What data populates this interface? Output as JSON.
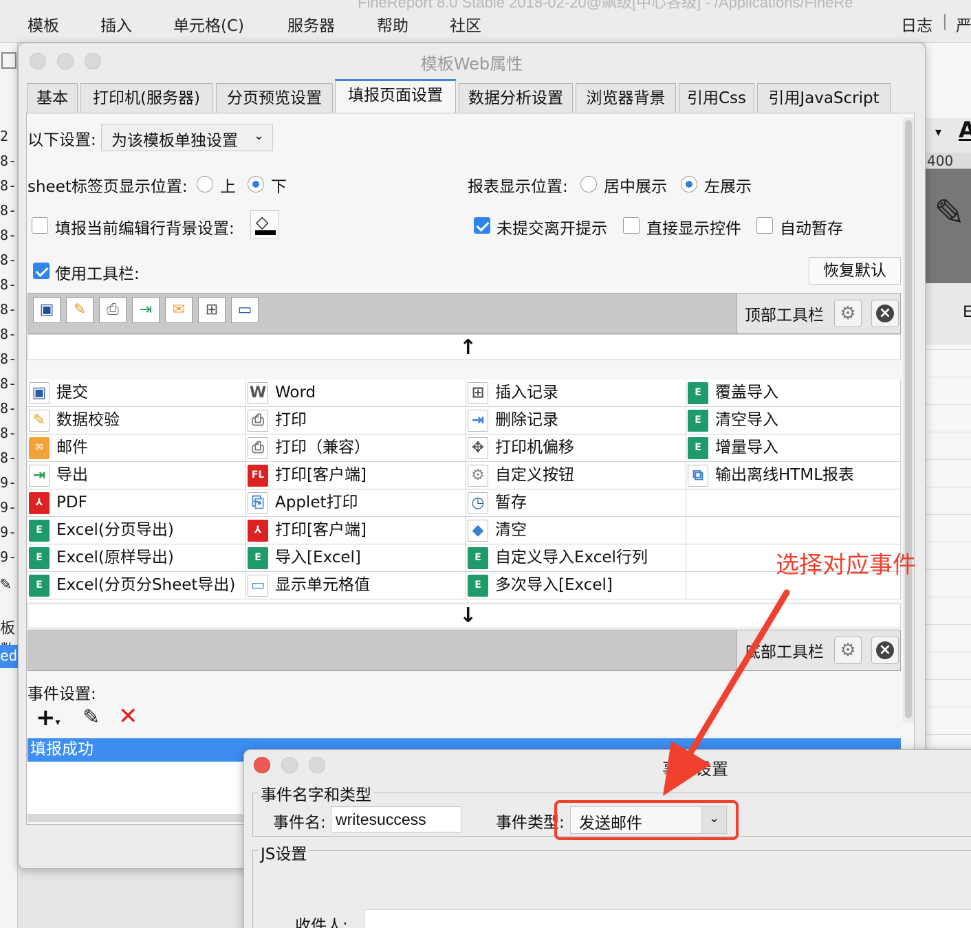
{
  "app_menu": {
    "items": [
      "模板",
      "插入",
      "单元格(C)",
      "服务器",
      "帮助",
      "社区"
    ],
    "right_items": [
      "日志",
      "|",
      "严"
    ],
    "ghost_title": "FineReport 8.0 Stable 2018-02-20@飙级[中心各级] - /Applications/FineRe"
  },
  "background": {
    "row_numbers": [
      "2",
      "8-",
      "8-",
      "8-",
      "8-",
      "8-",
      "8-",
      "8-",
      "8-",
      "8-",
      "8-",
      "8-",
      "8-",
      "8-",
      "9-",
      "9-",
      "9-",
      "9-"
    ],
    "side_labels": [
      "板数",
      "ed"
    ],
    "ruler": "400",
    "right_letter": "E",
    "right_arrow": "▾",
    "right_A": "A"
  },
  "window": {
    "title": "模板Web属性"
  },
  "tabs": [
    "基本",
    "打印机(服务器)",
    "分页预览设置",
    "填报页面设置",
    "数据分析设置",
    "浏览器背景",
    "引用Css",
    "引用JavaScript"
  ],
  "settings": {
    "scope_label": "以下设置:",
    "scope_value": "为该模板单独设置",
    "sheet_pos_label": "sheet标签页显示位置:",
    "sheet_top": "上",
    "sheet_bottom": "下",
    "report_pos_label": "报表显示位置:",
    "report_center": "居中展示",
    "report_left": "左展示",
    "edit_row_bg": "填报当前编辑行背景设置:",
    "unsubmitted_tip": "未提交离开提示",
    "direct_show": "直接显示控件",
    "auto_save": "自动暂存",
    "use_toolbar": "使用工具栏:",
    "restore_default": "恢复默认"
  },
  "top_toolbar": {
    "label": "顶部工具栏",
    "icons": [
      "save-icon",
      "validate-icon",
      "print-icon",
      "export-icon",
      "mail-icon",
      "insert-row-icon",
      "show-cell-icon"
    ]
  },
  "bottom_toolbar": {
    "label": "底部工具栏"
  },
  "buttons_grid": {
    "rows": [
      [
        {
          "t": "提交",
          "i": "save",
          "c": "#2d5aa8"
        },
        {
          "t": "Word",
          "i": "W",
          "c": "#555"
        },
        {
          "t": "插入记录",
          "i": "ins",
          "c": "#555"
        },
        {
          "t": "覆盖导入",
          "i": "E",
          "c": "#1f9a6a"
        }
      ],
      [
        {
          "t": "数据校验",
          "i": "val",
          "c": "#d6a21a"
        },
        {
          "t": "打印",
          "i": "prt",
          "c": "#777"
        },
        {
          "t": "删除记录",
          "i": "del",
          "c": "#3b7fd0"
        },
        {
          "t": "清空导入",
          "i": "E",
          "c": "#1f9a6a"
        }
      ],
      [
        {
          "t": "邮件",
          "i": "mail",
          "c": "#f1a33a"
        },
        {
          "t": "打印（兼容）",
          "i": "prt",
          "c": "#777"
        },
        {
          "t": "打印机偏移",
          "i": "mv",
          "c": "#555"
        },
        {
          "t": "增量导入",
          "i": "E",
          "c": "#1f9a6a"
        }
      ],
      [
        {
          "t": "导出",
          "i": "exp",
          "c": "#28a05a"
        },
        {
          "t": "打印[客户端]",
          "i": "FL",
          "c": "#d22"
        },
        {
          "t": "自定义按钮",
          "i": "gear",
          "c": "#888"
        },
        {
          "t": "输出离线HTML报表",
          "i": "htm",
          "c": "#3b7fd0"
        }
      ],
      [
        {
          "t": "PDF",
          "i": "pdf",
          "c": "#d22"
        },
        {
          "t": "Applet打印",
          "i": "apl",
          "c": "#3b7fd0"
        },
        {
          "t": "暂存",
          "i": "tmp",
          "c": "#2d5aa8"
        },
        {
          "t": "",
          "i": "",
          "c": ""
        }
      ],
      [
        {
          "t": "Excel(分页导出)",
          "i": "E",
          "c": "#1f9a6a"
        },
        {
          "t": "打印[客户端]",
          "i": "pdf",
          "c": "#d22"
        },
        {
          "t": "清空",
          "i": "clr",
          "c": "#3b7fd0"
        },
        {
          "t": "",
          "i": "",
          "c": ""
        }
      ],
      [
        {
          "t": "Excel(原样导出)",
          "i": "E",
          "c": "#1f9a6a"
        },
        {
          "t": "导入[Excel]",
          "i": "E",
          "c": "#1f9a6a"
        },
        {
          "t": "自定义导入Excel行列",
          "i": "E",
          "c": "#1f9a6a"
        },
        {
          "t": "",
          "i": "",
          "c": ""
        }
      ],
      [
        {
          "t": "Excel(分页分Sheet导出)",
          "i": "E",
          "c": "#1f9a6a"
        },
        {
          "t": "显示单元格值",
          "i": "cell",
          "c": "#3b7fd0"
        },
        {
          "t": "多次导入[Excel]",
          "i": "E",
          "c": "#1f9a6a"
        },
        {
          "t": "",
          "i": "",
          "c": ""
        }
      ]
    ]
  },
  "events": {
    "label": "事件设置:",
    "selected": "填报成功"
  },
  "dialog": {
    "title": "事件设置",
    "group1": "事件名字和类型",
    "name_label": "事件名:",
    "name_value": "writesuccess",
    "type_label": "事件类型:",
    "type_value": "发送邮件",
    "group2": "JS设置",
    "recipient_label": "收件人:"
  },
  "annotation": {
    "text": "选择对应事件",
    "color": "#f0402e"
  }
}
